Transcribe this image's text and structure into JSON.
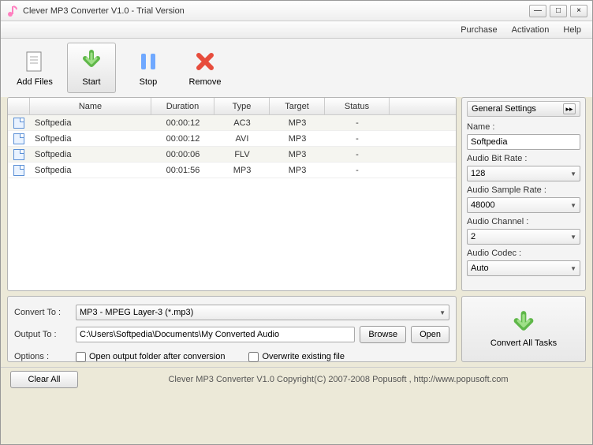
{
  "title": "Clever MP3 Converter V1.0  - Trial Version",
  "menu": {
    "purchase": "Purchase",
    "activation": "Activation",
    "help": "Help"
  },
  "toolbar": {
    "add_files": "Add Files",
    "start": "Start",
    "stop": "Stop",
    "remove": "Remove"
  },
  "table": {
    "headers": {
      "name": "Name",
      "duration": "Duration",
      "type": "Type",
      "target": "Target",
      "status": "Status"
    },
    "rows": [
      {
        "name": "Softpedia",
        "duration": "00:00:12",
        "type": "AC3",
        "target": "MP3",
        "status": "-"
      },
      {
        "name": "Softpedia",
        "duration": "00:00:12",
        "type": "AVI",
        "target": "MP3",
        "status": "-"
      },
      {
        "name": "Softpedia",
        "duration": "00:00:06",
        "type": "FLV",
        "target": "MP3",
        "status": "-"
      },
      {
        "name": "Softpedia",
        "duration": "00:01:56",
        "type": "MP3",
        "target": "MP3",
        "status": "-"
      }
    ]
  },
  "settings": {
    "header": "General Settings",
    "name_label": "Name :",
    "name_value": "Softpedia",
    "bitrate_label": "Audio Bit Rate :",
    "bitrate_value": "128",
    "samplerate_label": "Audio Sample Rate :",
    "samplerate_value": "48000",
    "channel_label": "Audio Channel :",
    "channel_value": "2",
    "codec_label": "Audio Codec :",
    "codec_value": "Auto"
  },
  "output": {
    "convert_to_label": "Convert To :",
    "convert_to_value": "MP3 - MPEG Layer-3 (*.mp3)",
    "output_to_label": "Output To :",
    "output_to_value": "C:\\Users\\Softpedia\\Documents\\My Converted Audio",
    "browse": "Browse",
    "open": "Open",
    "options_label": "Options :",
    "open_folder_label": "Open output folder after conversion",
    "overwrite_label": "Overwrite existing file"
  },
  "convert_all": "Convert All Tasks",
  "footer": {
    "clear_all": "Clear All",
    "copyright": "Clever MP3 Converter V1.0 Copyright(C) 2007-2008 Popusoft , http://www.popusoft.com"
  }
}
